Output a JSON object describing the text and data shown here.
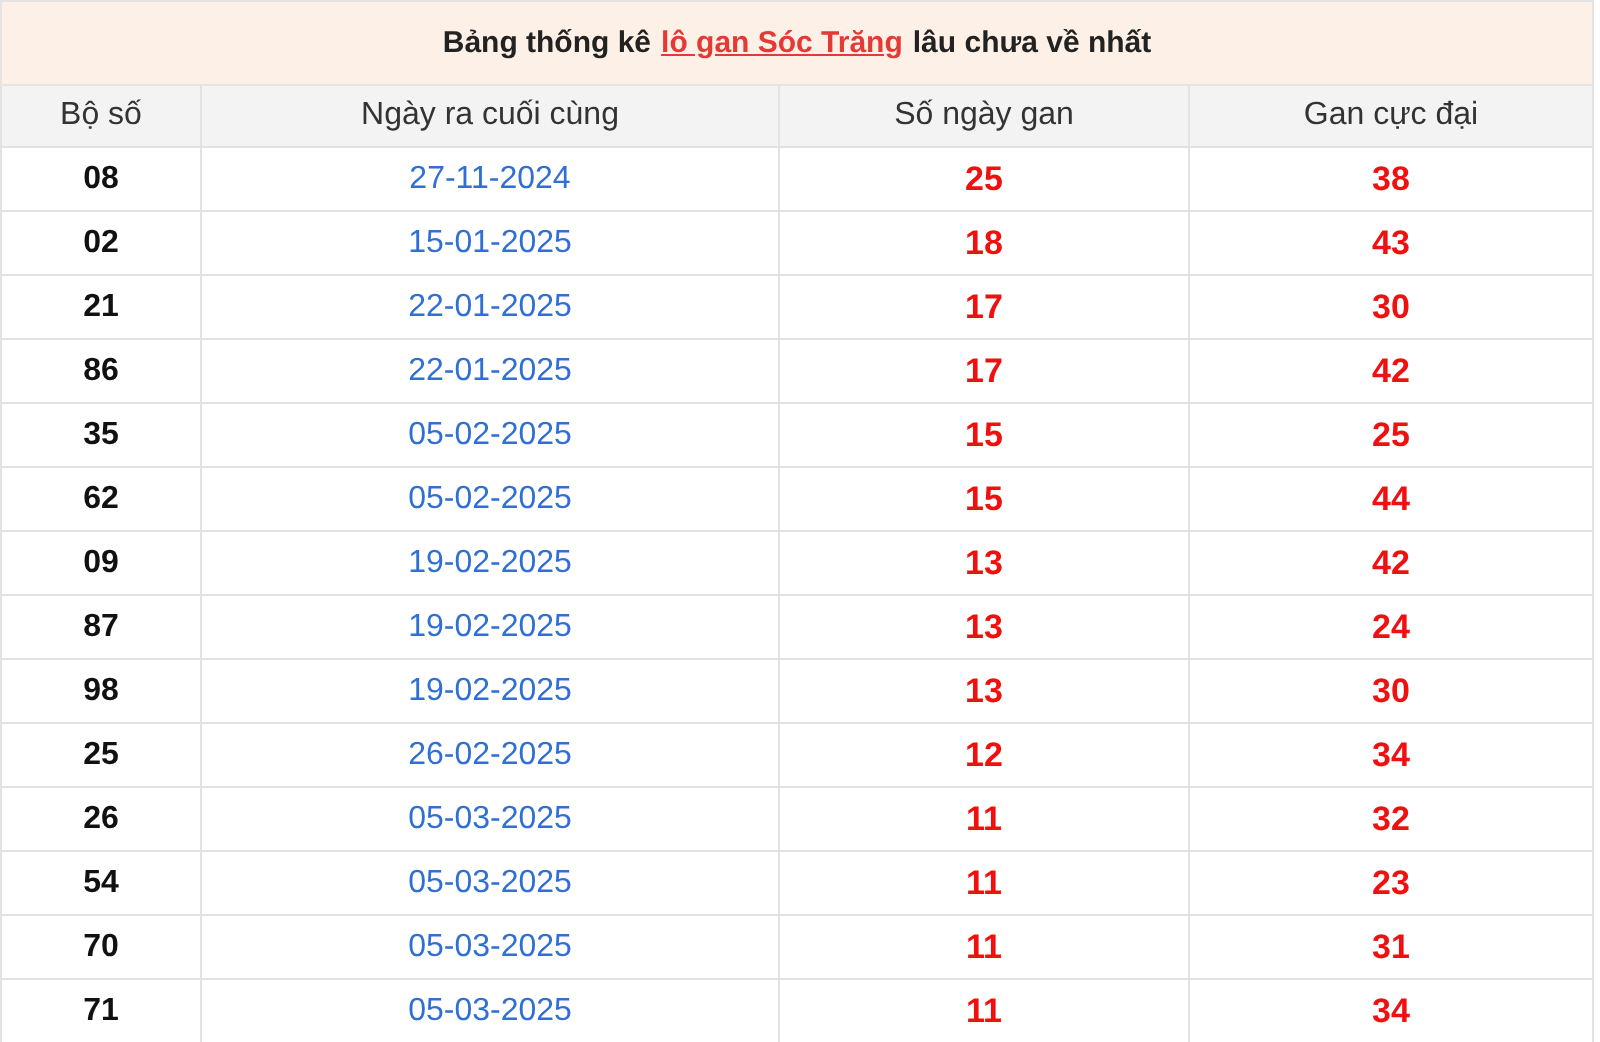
{
  "title": {
    "before": "Bảng thống kê",
    "link": "lô gan Sóc Trăng",
    "after": "lâu chưa về nhất"
  },
  "table": {
    "columns": [
      "Bộ số",
      "Ngày ra cuối cùng",
      "Số ngày gan",
      "Gan cực đại"
    ],
    "rows": [
      {
        "number": "08",
        "last_date": "27-11-2024",
        "days": "25",
        "max": "38"
      },
      {
        "number": "02",
        "last_date": "15-01-2025",
        "days": "18",
        "max": "43"
      },
      {
        "number": "21",
        "last_date": "22-01-2025",
        "days": "17",
        "max": "30"
      },
      {
        "number": "86",
        "last_date": "22-01-2025",
        "days": "17",
        "max": "42"
      },
      {
        "number": "35",
        "last_date": "05-02-2025",
        "days": "15",
        "max": "25"
      },
      {
        "number": "62",
        "last_date": "05-02-2025",
        "days": "15",
        "max": "44"
      },
      {
        "number": "09",
        "last_date": "19-02-2025",
        "days": "13",
        "max": "42"
      },
      {
        "number": "87",
        "last_date": "19-02-2025",
        "days": "13",
        "max": "24"
      },
      {
        "number": "98",
        "last_date": "19-02-2025",
        "days": "13",
        "max": "30"
      },
      {
        "number": "25",
        "last_date": "26-02-2025",
        "days": "12",
        "max": "34"
      },
      {
        "number": "26",
        "last_date": "05-03-2025",
        "days": "11",
        "max": "32"
      },
      {
        "number": "54",
        "last_date": "05-03-2025",
        "days": "11",
        "max": "23"
      },
      {
        "number": "70",
        "last_date": "05-03-2025",
        "days": "11",
        "max": "31"
      },
      {
        "number": "71",
        "last_date": "05-03-2025",
        "days": "11",
        "max": "34"
      }
    ]
  }
}
